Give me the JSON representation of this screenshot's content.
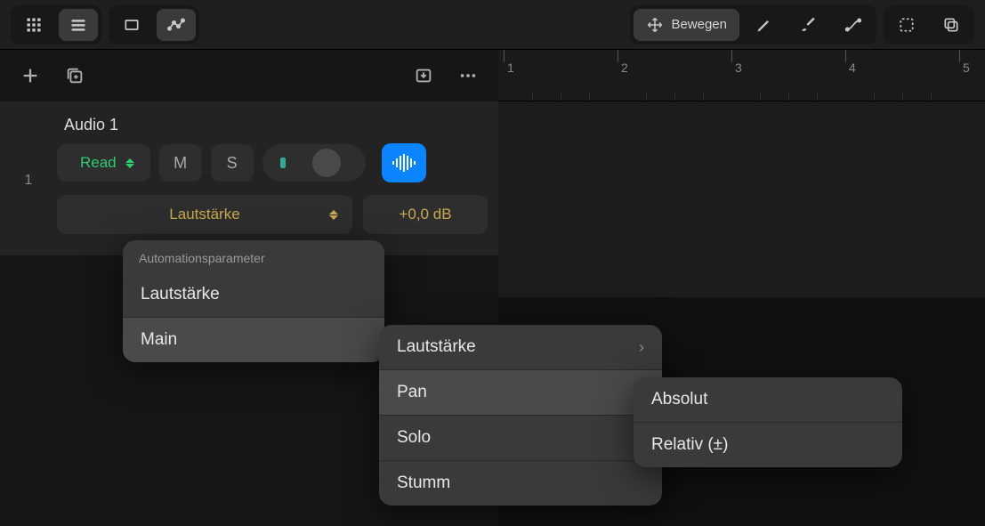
{
  "topbar": {
    "move_label": "Bewegen"
  },
  "track": {
    "number": "1",
    "name": "Audio 1",
    "read_label": "Read",
    "mute_label": "M",
    "solo_label": "S",
    "param_name": "Lautstärke",
    "param_value": "+0,0 dB"
  },
  "ruler": {
    "marks": [
      "1",
      "2",
      "3",
      "4",
      "5"
    ]
  },
  "menu1": {
    "header": "Automationsparameter",
    "items": [
      {
        "label": "Lautstärke",
        "highlighted": false
      },
      {
        "label": "Main",
        "highlighted": true
      }
    ]
  },
  "menu2": {
    "items": [
      {
        "label": "Lautstärke",
        "highlighted": false,
        "chevron": true
      },
      {
        "label": "Pan",
        "highlighted": true,
        "chevron": false
      },
      {
        "label": "Solo",
        "highlighted": false,
        "chevron": false
      },
      {
        "label": "Stumm",
        "highlighted": false,
        "chevron": false
      }
    ]
  },
  "menu3": {
    "items": [
      {
        "label": "Absolut",
        "highlighted": false
      },
      {
        "label": "Relativ (±)",
        "highlighted": false
      }
    ]
  }
}
